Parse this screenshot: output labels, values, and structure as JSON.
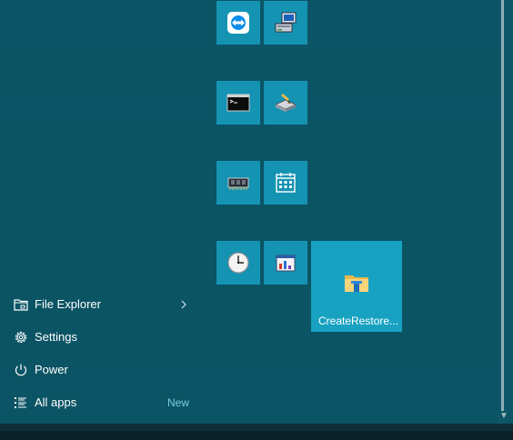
{
  "menu": {
    "items": [
      {
        "label": "File Explorer",
        "icon": "folder-icon",
        "has_chevron": true
      },
      {
        "label": "Settings",
        "icon": "gear-icon"
      },
      {
        "label": "Power",
        "icon": "power-icon"
      },
      {
        "label": "All apps",
        "icon": "list-icon",
        "badge": "New"
      }
    ]
  },
  "tiles": [
    {
      "icon": "teamviewer-icon"
    },
    {
      "icon": "computer-network-icon"
    },
    {
      "icon": "command-prompt-icon"
    },
    {
      "icon": "disk-tool-icon"
    },
    {
      "icon": "memory-chip-icon"
    },
    {
      "icon": "calendar-icon"
    },
    {
      "icon": "clock-icon"
    },
    {
      "icon": "chart-app-icon"
    },
    {
      "icon": "folder-icon",
      "label": "CreateRestore..."
    }
  ],
  "colors": {
    "background": "#0b5566",
    "tile": "#1593b3",
    "tile_wide": "#18a2c2",
    "accent_text": "#78cde6",
    "taskbar": "#0e2e39"
  }
}
